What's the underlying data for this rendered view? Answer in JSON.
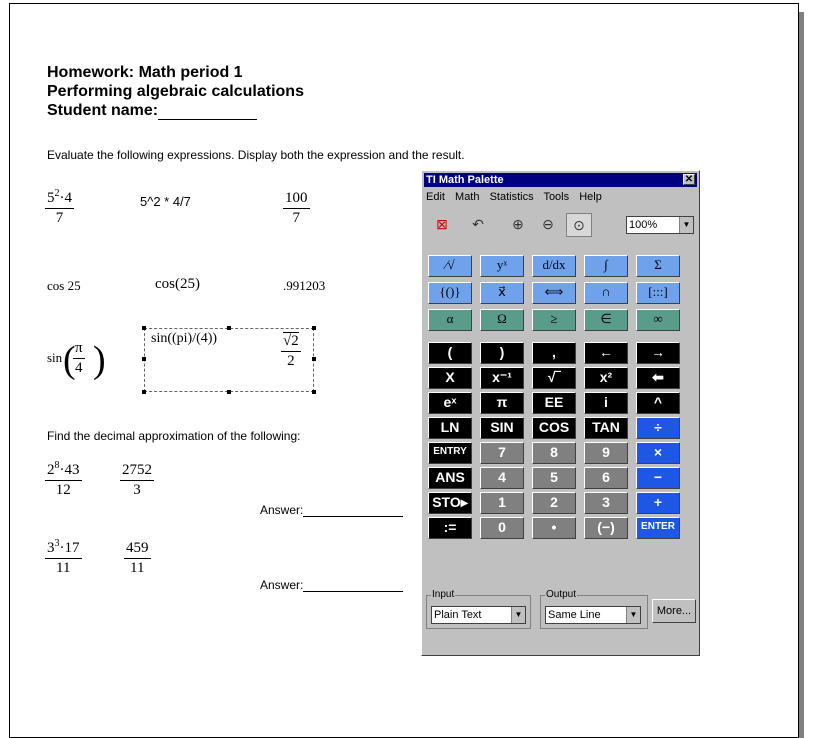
{
  "document": {
    "title_line1": "Homework:  Math period 1",
    "title_line2": "Performing algebraic calculations",
    "title_line3": "Student name:",
    "instruction1": "Evaluate the following expressions.  Display both the expression and the result.",
    "row1": {
      "num": "5",
      "num_exp": "2",
      "num_rest": "·4",
      "den": "7",
      "plain": "5^2 * 4/7",
      "res_num": "100",
      "res_den": "7"
    },
    "row2": {
      "expr": "cos 25",
      "plain": "cos(25)",
      "result": ".991203"
    },
    "row3": {
      "expr_fn": "sin",
      "pi": "π",
      "den": "4",
      "plain": "sin((pi)/(4))",
      "res_sqrt": "2",
      "res_den": "2"
    },
    "instruction2": "Find the decimal approximation of the following:",
    "row4": {
      "num": "2",
      "num_exp": "8",
      "num_rest": "·43",
      "den": "12",
      "res_num": "2752",
      "res_den": "3",
      "answer_label": "Answer:"
    },
    "row5": {
      "num": "3",
      "num_exp": "3",
      "num_rest": "·17",
      "den": "11",
      "res_num": "459",
      "res_den": "11",
      "answer_label": "Answer:"
    }
  },
  "palette": {
    "title": "TI Math Palette",
    "menu": [
      "Edit",
      "Math",
      "Statistics",
      "Tools",
      "Help"
    ],
    "zoom": "100%",
    "template_rows": [
      [
        "⁄√",
        "yˣ",
        "d/dx",
        "∫",
        "Σ"
      ],
      [
        "{()}",
        "x⃗",
        "⟺",
        "∩",
        "[:::]"
      ],
      [
        "α",
        "Ω",
        "≥",
        "∈",
        "∞"
      ]
    ],
    "key_rows": [
      [
        "(",
        ")",
        ",",
        "←",
        "→"
      ],
      [
        "X",
        "x⁻¹",
        "√‾",
        "x²",
        "⬅"
      ],
      [
        "eˣ",
        "π",
        "EE",
        "i",
        "^"
      ],
      [
        "LN",
        "SIN",
        "COS",
        "TAN",
        "÷"
      ],
      [
        "ENTRY",
        "7",
        "8",
        "9",
        "×"
      ],
      [
        "ANS",
        "4",
        "5",
        "6",
        "−"
      ],
      [
        "STO▸",
        "1",
        "2",
        "3",
        "+"
      ],
      [
        ":=",
        "0",
        "•",
        "(−)",
        "ENTER"
      ]
    ],
    "input_label": "Input",
    "input_value": "Plain Text",
    "output_label": "Output",
    "output_value": "Same Line",
    "more_label": "More..."
  }
}
